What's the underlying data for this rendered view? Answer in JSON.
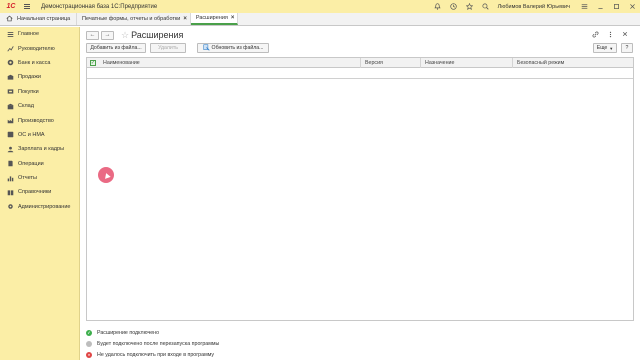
{
  "titlebar": {
    "logo_text": "1С",
    "app_title": "Демонстрационная база 1С:Предприятие",
    "user_name": "Любимов Валерий Юрьевич",
    "icons": [
      "bell-icon",
      "history-icon",
      "star-icon",
      "search-icon",
      "menu-icon",
      "minimize-icon",
      "maximize-icon",
      "close-icon"
    ]
  },
  "tabs": {
    "home_label": "Начальная страница",
    "items": [
      {
        "label": "Печатные формы, отчеты и обработки",
        "active": false
      },
      {
        "label": "Расширения",
        "active": true
      }
    ],
    "close_glyph": "×"
  },
  "sidebar": {
    "items": [
      {
        "label": "Главное",
        "icon": "list-icon"
      },
      {
        "label": "Руководителю",
        "icon": "chart-icon"
      },
      {
        "label": "Банк и касса",
        "icon": "bank-icon"
      },
      {
        "label": "Продажи",
        "icon": "sales-icon"
      },
      {
        "label": "Покупки",
        "icon": "cart-icon"
      },
      {
        "label": "Склад",
        "icon": "warehouse-icon"
      },
      {
        "label": "Производство",
        "icon": "production-icon"
      },
      {
        "label": "ОС и НМА",
        "icon": "assets-icon"
      },
      {
        "label": "Зарплата и кадры",
        "icon": "people-icon"
      },
      {
        "label": "Операции",
        "icon": "operations-icon"
      },
      {
        "label": "Отчеты",
        "icon": "reports-icon"
      },
      {
        "label": "Справочники",
        "icon": "book-icon"
      },
      {
        "label": "Администрирование",
        "icon": "gear-icon"
      }
    ]
  },
  "page": {
    "title": "Расширения",
    "back_glyph": "←",
    "forward_glyph": "→",
    "star_glyph": "☆"
  },
  "toolbar": {
    "add_label": "Добавить из файла...",
    "delete_label": "Удалить",
    "update_label": "Обновить из файла...",
    "more_label": "Еще",
    "help_label": "?"
  },
  "grid": {
    "columns": [
      "Наименование",
      "Версия",
      "Назначение",
      "Безопасный режим"
    ],
    "rows": []
  },
  "legend": [
    {
      "label": "Расширение подключено",
      "color": "#3cae4b",
      "glyph": "✓"
    },
    {
      "label": "Будет подключено после перезапуска программы",
      "color": "#bdbdbd",
      "glyph": ""
    },
    {
      "label": "Не удалось подключить при входе в программу",
      "color": "#e04646",
      "glyph": "×"
    }
  ],
  "colors": {
    "accent_yellow": "#fbeea6",
    "active_tab_underline": "#4aa04a",
    "cursor_highlight": "#e6506e"
  }
}
